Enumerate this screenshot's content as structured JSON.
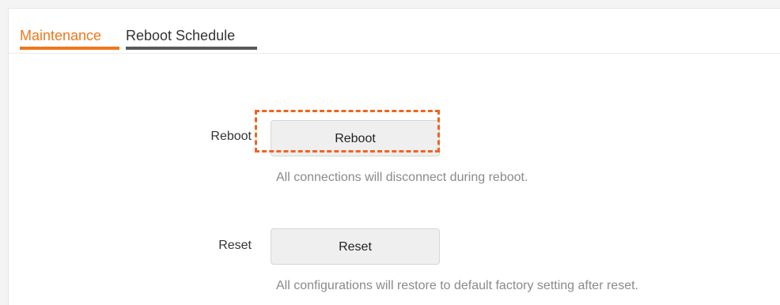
{
  "tabs": [
    {
      "label": "Maintenance",
      "active": true
    },
    {
      "label": "Reboot Schedule",
      "active": false
    }
  ],
  "reboot": {
    "label": "Reboot",
    "button_label": "Reboot",
    "hint": "All connections will disconnect during reboot."
  },
  "reset": {
    "label": "Reset",
    "button_label": "Reset",
    "hint": "All configurations will restore to default factory setting after reset."
  },
  "colors": {
    "accent": "#f0781c",
    "highlight": "#f0641e",
    "inactive_tab_underline": "#5a5a5a",
    "hint_text": "#8a8a8a"
  }
}
